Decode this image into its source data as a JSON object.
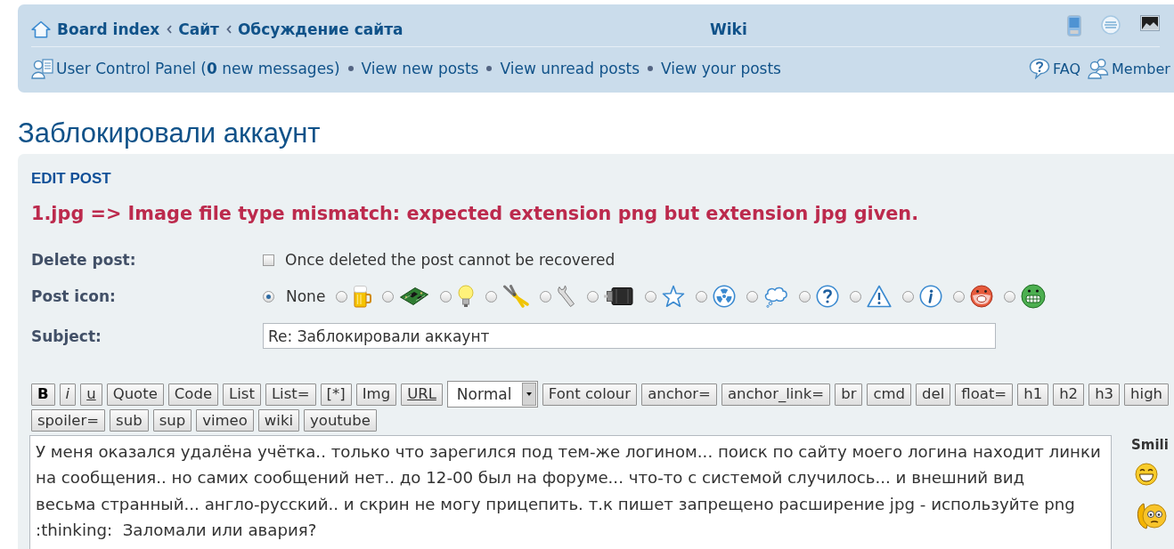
{
  "navbar": {
    "breadcrumbs": [
      {
        "label": "Board index"
      },
      {
        "label": "Сайт"
      },
      {
        "label": "Обсуждение сайта"
      }
    ],
    "center_link": "Wiki",
    "user_links": [
      {
        "label": "User Control Panel (**0** new messages)"
      },
      {
        "label": "View new posts"
      },
      {
        "label": "View unread posts"
      },
      {
        "label": "View your posts"
      }
    ],
    "right_links": [
      {
        "label": "FAQ"
      },
      {
        "label": "Member"
      }
    ]
  },
  "topic_title": "Заблокировали аккаунт",
  "edit_panel": {
    "heading": "EDIT POST",
    "error": "1.jpg => Image file type mismatch: expected extension png but extension jpg given.",
    "delete_post": {
      "label": "Delete post:",
      "checked": false,
      "note": "Once deleted the post cannot be recovered"
    },
    "post_icon": {
      "label": "Post icon:",
      "options": [
        {
          "label": "None",
          "selected": true
        },
        {
          "selected": false
        },
        {
          "selected": false
        },
        {
          "selected": false
        },
        {
          "selected": false
        },
        {
          "selected": false
        },
        {
          "selected": false
        },
        {
          "selected": false
        },
        {
          "selected": false
        },
        {
          "selected": false
        },
        {
          "selected": false
        },
        {
          "selected": false
        },
        {
          "selected": false
        },
        {
          "selected": false
        },
        {
          "selected": false
        }
      ]
    },
    "subject": {
      "label": "Subject:",
      "value": "Re: Заблокировали аккаунт"
    },
    "toolbar": {
      "buttons": [
        {
          "label": "B",
          "kind": "bold"
        },
        {
          "label": "i",
          "kind": "italic"
        },
        {
          "label": "u",
          "kind": "underline"
        },
        {
          "label": "Quote",
          "kind": "plain"
        },
        {
          "label": "Code",
          "kind": "plain"
        },
        {
          "label": "List",
          "kind": "plain"
        },
        {
          "label": "List=",
          "kind": "plain"
        },
        {
          "label": "[*]",
          "kind": "plain"
        },
        {
          "label": "Img",
          "kind": "plain"
        },
        {
          "label": "URL",
          "kind": "underline"
        },
        {
          "label": "Normal",
          "kind": "select"
        },
        {
          "label": "Font colour",
          "kind": "plain"
        },
        {
          "label": "anchor=",
          "kind": "plain"
        },
        {
          "label": "anchor_link=",
          "kind": "plain"
        },
        {
          "label": "br",
          "kind": "plain"
        },
        {
          "label": "cmd",
          "kind": "plain"
        },
        {
          "label": "del",
          "kind": "plain"
        },
        {
          "label": "float=",
          "kind": "plain"
        },
        {
          "label": "h1",
          "kind": "plain"
        },
        {
          "label": "h2",
          "kind": "plain"
        },
        {
          "label": "h3",
          "kind": "plain"
        },
        {
          "label": "high",
          "kind": "plain"
        },
        {
          "label": "spoiler=",
          "kind": "plain"
        },
        {
          "label": "sub",
          "kind": "plain"
        },
        {
          "label": "sup",
          "kind": "plain"
        },
        {
          "label": "vimeo",
          "kind": "plain"
        },
        {
          "label": "wiki",
          "kind": "plain"
        },
        {
          "label": "youtube",
          "kind": "plain"
        }
      ]
    },
    "message": "У меня оказался удалёна учётка.. только что зарегился под тем-же логином... поиск по сайту моего логина находит линки на сообщения.. но самих сообщений нет.. до 12-00 был на форуме... что-то с системой случилось... и внешний вид\nвесьма странный... англо-русский.. и скрин не могу прицепить. т.к пишет запрещено расширение jpg - используйте png :thinking:  Заломали или авария?",
    "smilies": {
      "title": "Smili"
    }
  }
}
